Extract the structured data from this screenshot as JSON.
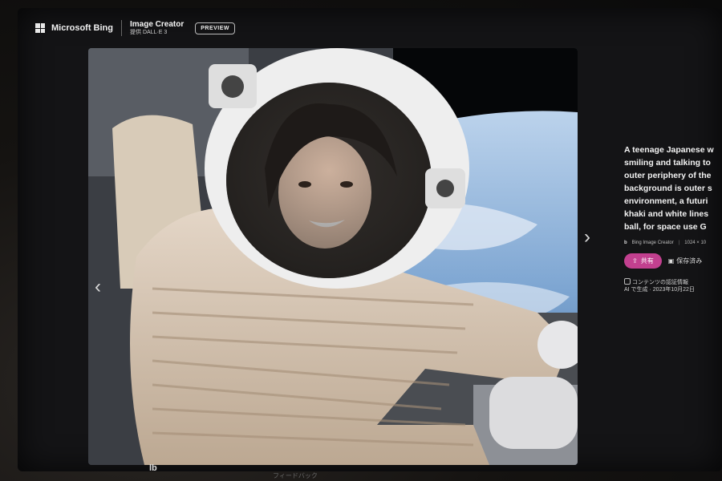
{
  "header": {
    "brand": "Microsoft Bing",
    "app_title": "Image Creator",
    "app_subtitle": "提供 DALL·E 3",
    "preview_badge": "PREVIEW"
  },
  "nav": {
    "prev_icon": "chevron-left-icon",
    "next_icon": "chevron-right-icon",
    "prev_glyph": "‹",
    "next_glyph": "›"
  },
  "info": {
    "prompt_lines": [
      "A teenage Japanese w",
      "smiling and talking to",
      "outer periphery of the",
      "background is outer s",
      "environment, a futuri",
      "khaki and white lines",
      "ball, for space use G"
    ],
    "source": "Bing Image Creator",
    "separator": "|",
    "resolution": "1024 × 10",
    "share_label": "共有",
    "save_label": "保存済み",
    "content_credentials": "コンテンツの認証情報",
    "generated_line": "AI で生成 · 2023年10月22日"
  },
  "footer": {
    "feedback": "フィードバック",
    "corner_glyph": "lb"
  },
  "colors": {
    "share_accent": "#c2408f",
    "background": "#141416"
  }
}
